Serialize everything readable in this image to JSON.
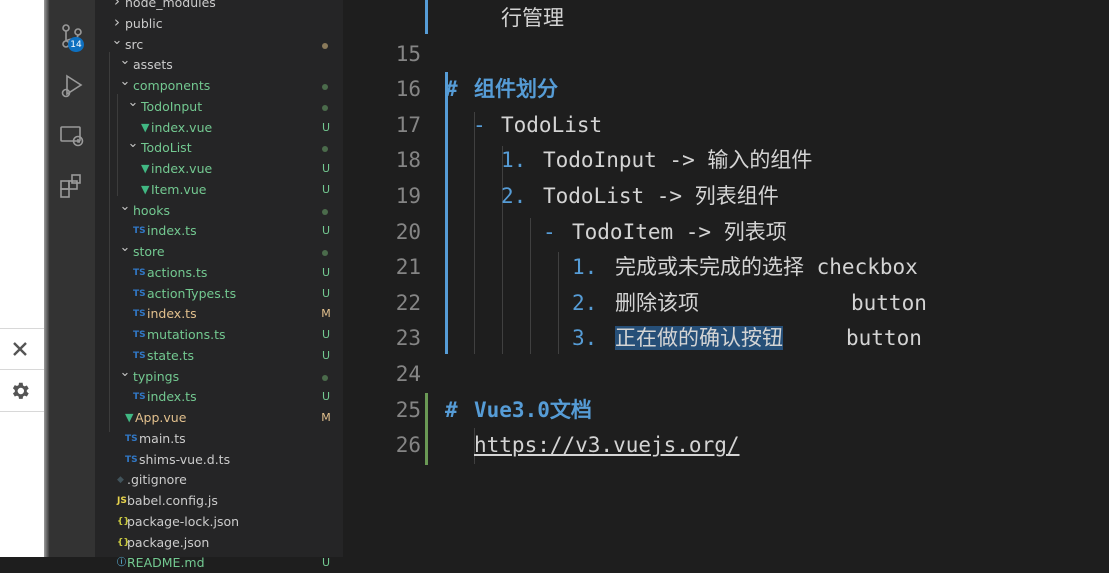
{
  "sidebar": {
    "items": [
      {
        "label": "node_modules",
        "kind": "folder",
        "expanded": false,
        "depth": 0,
        "status": ""
      },
      {
        "label": "public",
        "kind": "folder",
        "expanded": false,
        "depth": 0,
        "status": ""
      },
      {
        "label": "src",
        "kind": "folder",
        "expanded": true,
        "depth": 0,
        "status": "dot-ochre"
      },
      {
        "label": "assets",
        "kind": "folder",
        "expanded": true,
        "depth": 1,
        "status": ""
      },
      {
        "label": "components",
        "kind": "folder",
        "expanded": true,
        "depth": 1,
        "status": "dot"
      },
      {
        "label": "TodoInput",
        "kind": "folder",
        "expanded": true,
        "depth": 2,
        "status": "dot"
      },
      {
        "label": "index.vue",
        "kind": "vue",
        "depth": 3,
        "status": "U"
      },
      {
        "label": "TodoList",
        "kind": "folder",
        "expanded": true,
        "depth": 2,
        "status": "dot"
      },
      {
        "label": "index.vue",
        "kind": "vue",
        "depth": 3,
        "status": "U"
      },
      {
        "label": "Item.vue",
        "kind": "vue",
        "depth": 3,
        "status": "U"
      },
      {
        "label": "hooks",
        "kind": "folder",
        "expanded": true,
        "depth": 1,
        "status": "dot"
      },
      {
        "label": "index.ts",
        "kind": "ts",
        "depth": 2,
        "status": "U"
      },
      {
        "label": "store",
        "kind": "folder",
        "expanded": true,
        "depth": 1,
        "status": "dot"
      },
      {
        "label": "actions.ts",
        "kind": "ts",
        "depth": 2,
        "status": "U"
      },
      {
        "label": "actionTypes.ts",
        "kind": "ts",
        "depth": 2,
        "status": "U"
      },
      {
        "label": "index.ts",
        "kind": "ts",
        "depth": 2,
        "status": "M"
      },
      {
        "label": "mutations.ts",
        "kind": "ts",
        "depth": 2,
        "status": "U"
      },
      {
        "label": "state.ts",
        "kind": "ts",
        "depth": 2,
        "status": "U"
      },
      {
        "label": "typings",
        "kind": "folder",
        "expanded": true,
        "depth": 1,
        "status": "dot"
      },
      {
        "label": "index.ts",
        "kind": "ts",
        "depth": 2,
        "status": "U"
      },
      {
        "label": "App.vue",
        "kind": "vue",
        "depth": 1,
        "status": "M"
      },
      {
        "label": "main.ts",
        "kind": "ts",
        "depth": 1,
        "status": ""
      },
      {
        "label": "shims-vue.d.ts",
        "kind": "ts",
        "depth": 1,
        "status": ""
      },
      {
        "label": ".gitignore",
        "kind": "git",
        "depth": 0,
        "status": ""
      },
      {
        "label": "babel.config.js",
        "kind": "js",
        "depth": 0,
        "status": ""
      },
      {
        "label": "package-lock.json",
        "kind": "json",
        "depth": 0,
        "status": ""
      },
      {
        "label": "package.json",
        "kind": "json",
        "depth": 0,
        "status": ""
      },
      {
        "label": "README.md",
        "kind": "md",
        "depth": 0,
        "status": "U"
      }
    ]
  },
  "icons": {
    "vue": "▼",
    "ts": "TS",
    "js": "JS",
    "json": "{}",
    "git": "◆",
    "md": "ⓘ"
  },
  "activity": {
    "scm_badge": "14"
  },
  "editor": {
    "lines": [
      {
        "num": "",
        "text": "行管理"
      },
      {
        "num": "15",
        "text": ""
      },
      {
        "num": "16",
        "hash": "#",
        "text": "组件划分"
      },
      {
        "num": "17",
        "marker": "-",
        "text": "TodoList"
      },
      {
        "num": "18",
        "marker": "1.",
        "text": "TodoInput -> 输入的组件"
      },
      {
        "num": "19",
        "marker": "2.",
        "text": "TodoList -> 列表组件"
      },
      {
        "num": "20",
        "marker": "-",
        "text": "TodoItem -> 列表项"
      },
      {
        "num": "21",
        "marker": "1.",
        "text": "完成或未完成的选择 checkbox"
      },
      {
        "num": "22",
        "marker": "2.",
        "text": "删除该项",
        "extra": "button"
      },
      {
        "num": "23",
        "marker": "3.",
        "text": "正在做的确认按钮",
        "extra": "button"
      },
      {
        "num": "24",
        "text": ""
      },
      {
        "num": "25",
        "hash": "#",
        "text": "Vue3.0文档"
      },
      {
        "num": "26",
        "text": "https://v3.vuejs.org/"
      }
    ]
  },
  "colors": {
    "folder": "#cccccc",
    "vue": "#41b883",
    "ts": "#3178c6",
    "js": "#e8d44d",
    "json": "#cbcb41",
    "git": "#41535b",
    "md": "#519aba",
    "untracked": "#73c991",
    "modified": "#e2c08d",
    "accent": "#569cd6",
    "selection": "#264f78"
  }
}
